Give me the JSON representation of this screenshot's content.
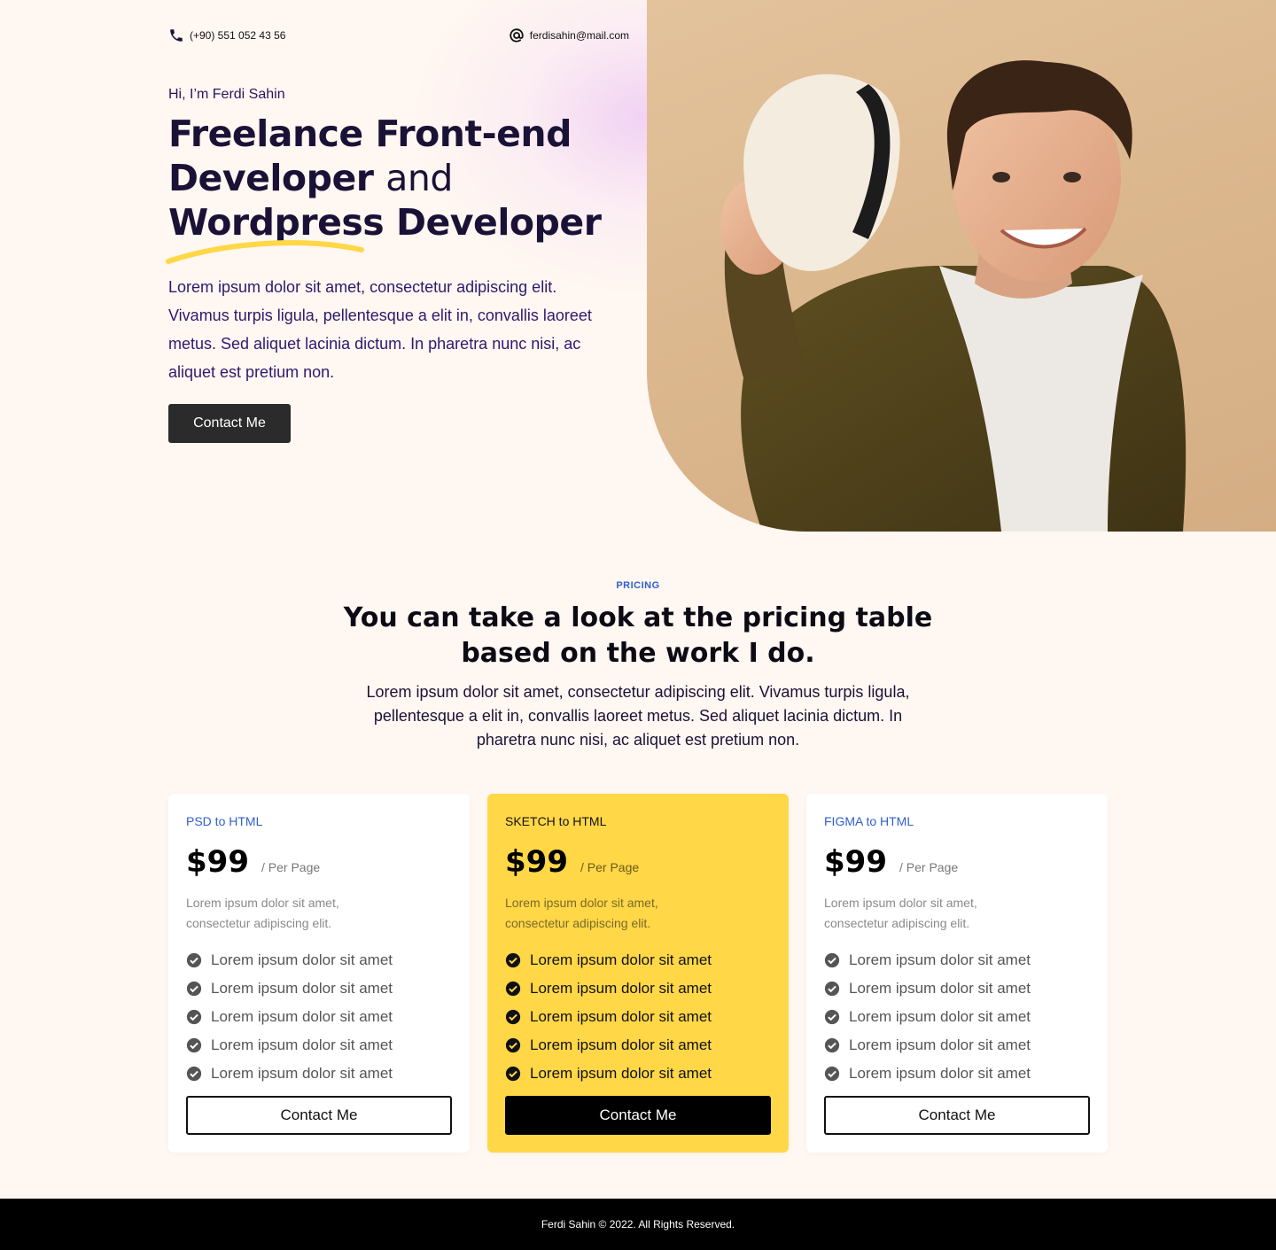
{
  "contact": {
    "phone": "(+90) 551 052 43 56",
    "email": "ferdisahin@mail.com"
  },
  "hero": {
    "greeting": "Hi, I’m Ferdi Sahin",
    "headline_line1": "Freelance Front-end",
    "headline_line2_bold": "Developer",
    "headline_line2_normal": "and",
    "headline_line3": "Wordpress Developer",
    "description": "Lorem ipsum dolor sit amet, consectetur adipiscing elit. Vivamus turpis ligula, pellentesque a elit in, convallis laoreet metus. Sed aliquet lacinia dictum. In pharetra nunc nisi, ac aliquet est pretium non.",
    "cta_label": "Contact Me",
    "accent_color": "#ffd747"
  },
  "pricing": {
    "eyebrow": "PRICING",
    "title": "You can take a look at the pricing table based on the work I do.",
    "description": "Lorem ipsum dolor sit amet, consectetur adipiscing elit. Vivamus turpis ligula, pellentesque a elit in, convallis laoreet metus. Sed aliquet lacinia dictum. In pharetra nunc nisi, ac aliquet est pretium non.",
    "plans": [
      {
        "name": "PSD to HTML",
        "price": "$99",
        "period": "/ Per Page",
        "description": "Lorem ipsum dolor sit amet, consectetur adipiscing elit.",
        "features": [
          "Lorem ipsum dolor sit amet",
          "Lorem ipsum dolor sit amet",
          "Lorem ipsum dolor sit amet",
          "Lorem ipsum dolor sit amet",
          "Lorem ipsum dolor sit amet"
        ],
        "button_label": "Contact Me"
      },
      {
        "name": "SKETCH to HTML",
        "price": "$99",
        "period": "/ Per Page",
        "description": "Lorem ipsum dolor sit amet, consectetur adipiscing elit.",
        "features": [
          "Lorem ipsum dolor sit amet",
          "Lorem ipsum dolor sit amet",
          "Lorem ipsum dolor sit amet",
          "Lorem ipsum dolor sit amet",
          "Lorem ipsum dolor sit amet"
        ],
        "button_label": "Contact Me"
      },
      {
        "name": "FIGMA to HTML",
        "price": "$99",
        "period": "/ Per Page",
        "description": "Lorem ipsum dolor sit amet, consectetur adipiscing elit.",
        "features": [
          "Lorem ipsum dolor sit amet",
          "Lorem ipsum dolor sit amet",
          "Lorem ipsum dolor sit amet",
          "Lorem ipsum dolor sit amet",
          "Lorem ipsum dolor sit amet"
        ],
        "button_label": "Contact Me"
      }
    ]
  },
  "footer": {
    "copyright": "Ferdi Sahin © 2022. All Rights Reserved."
  }
}
